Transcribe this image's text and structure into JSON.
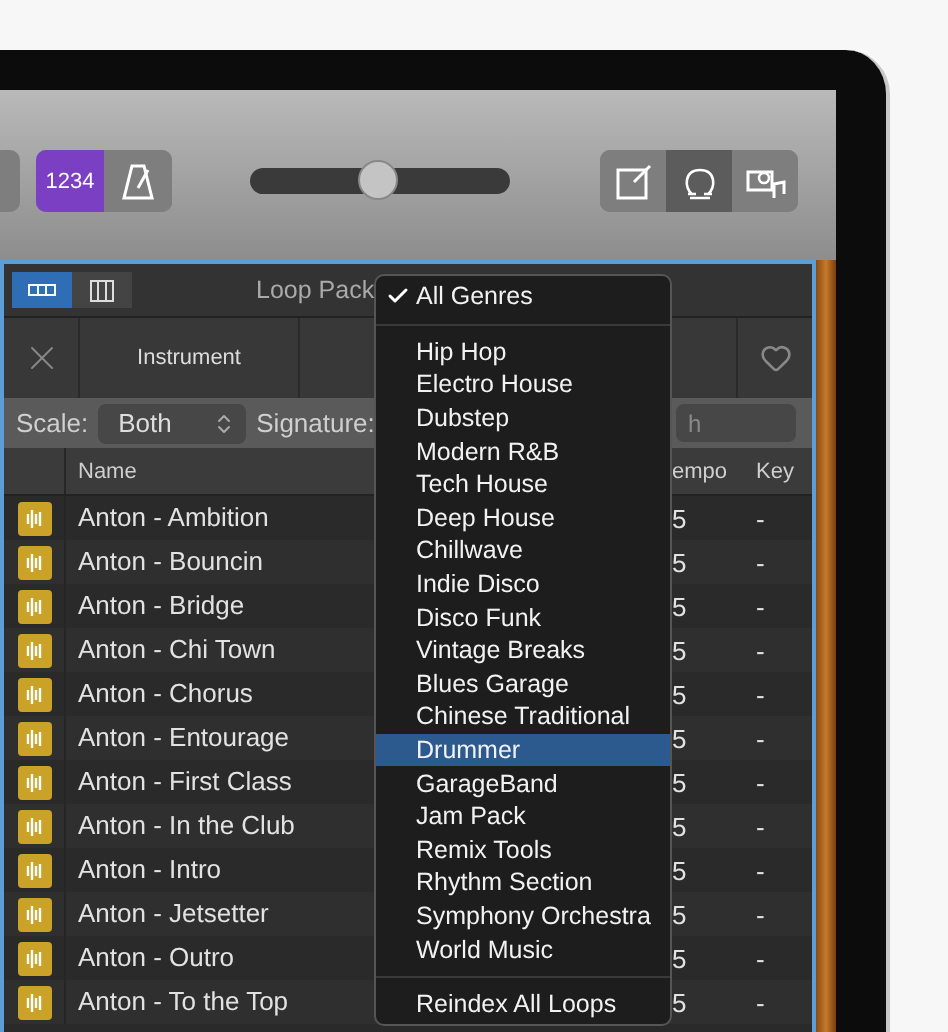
{
  "toolbar": {
    "count_in": {
      "label": "1234",
      "on": true
    },
    "metronome": {
      "on": false
    },
    "volume": {
      "level": 0.49
    },
    "view_buttons": [
      {
        "kind": "editor",
        "selected": false
      },
      {
        "kind": "loops",
        "selected": true
      },
      {
        "kind": "media",
        "selected": false
      }
    ]
  },
  "loop_browser": {
    "view_modes": [
      {
        "kind": "buttons",
        "selected": true
      },
      {
        "kind": "columns",
        "selected": false
      }
    ],
    "title": "Loop Pack",
    "filter_tab": "Instrument",
    "scale": {
      "label": "Scale:",
      "value": "Both"
    },
    "signature": {
      "label": "Signature:"
    },
    "search": {
      "placeholder": "h"
    },
    "columns": [
      "Name",
      "empo",
      "Key"
    ],
    "rows": [
      {
        "name": "Anton - Ambition",
        "tempo": "5",
        "key": "-"
      },
      {
        "name": "Anton - Bouncin",
        "tempo": "5",
        "key": "-"
      },
      {
        "name": "Anton - Bridge",
        "tempo": "5",
        "key": "-"
      },
      {
        "name": "Anton - Chi Town",
        "tempo": "5",
        "key": "-"
      },
      {
        "name": "Anton - Chorus",
        "tempo": "5",
        "key": "-"
      },
      {
        "name": "Anton - Entourage",
        "tempo": "5",
        "key": "-"
      },
      {
        "name": "Anton - First Class",
        "tempo": "5",
        "key": "-"
      },
      {
        "name": "Anton - In the Club",
        "tempo": "5",
        "key": "-"
      },
      {
        "name": "Anton - Intro",
        "tempo": "5",
        "key": "-"
      },
      {
        "name": "Anton - Jetsetter",
        "tempo": "5",
        "key": "-"
      },
      {
        "name": "Anton - Outro",
        "tempo": "5",
        "key": "-"
      },
      {
        "name": "Anton - To the Top",
        "tempo": "5",
        "key": "-"
      }
    ]
  },
  "genre_menu": {
    "items": [
      {
        "kind": "item",
        "label": "All Genres",
        "checked": true,
        "highlighted": false
      },
      {
        "kind": "separator"
      },
      {
        "kind": "item",
        "label": "Hip Hop",
        "checked": false,
        "highlighted": false
      },
      {
        "kind": "item",
        "label": "Electro House",
        "checked": false,
        "highlighted": false
      },
      {
        "kind": "item",
        "label": "Dubstep",
        "checked": false,
        "highlighted": false
      },
      {
        "kind": "item",
        "label": "Modern R&B",
        "checked": false,
        "highlighted": false
      },
      {
        "kind": "item",
        "label": "Tech House",
        "checked": false,
        "highlighted": false
      },
      {
        "kind": "item",
        "label": "Deep House",
        "checked": false,
        "highlighted": false
      },
      {
        "kind": "item",
        "label": "Chillwave",
        "checked": false,
        "highlighted": false
      },
      {
        "kind": "item",
        "label": "Indie Disco",
        "checked": false,
        "highlighted": false
      },
      {
        "kind": "item",
        "label": "Disco Funk",
        "checked": false,
        "highlighted": false
      },
      {
        "kind": "item",
        "label": "Vintage Breaks",
        "checked": false,
        "highlighted": false
      },
      {
        "kind": "item",
        "label": "Blues Garage",
        "checked": false,
        "highlighted": false
      },
      {
        "kind": "item",
        "label": "Chinese Traditional",
        "checked": false,
        "highlighted": false
      },
      {
        "kind": "item",
        "label": "Drummer",
        "checked": false,
        "highlighted": true
      },
      {
        "kind": "item",
        "label": "GarageBand",
        "checked": false,
        "highlighted": false
      },
      {
        "kind": "item",
        "label": "Jam Pack",
        "checked": false,
        "highlighted": false
      },
      {
        "kind": "item",
        "label": "Remix Tools",
        "checked": false,
        "highlighted": false
      },
      {
        "kind": "item",
        "label": "Rhythm Section",
        "checked": false,
        "highlighted": false
      },
      {
        "kind": "item",
        "label": "Symphony Orchestra",
        "checked": false,
        "highlighted": false
      },
      {
        "kind": "item",
        "label": "World Music",
        "checked": false,
        "highlighted": false
      },
      {
        "kind": "separator"
      },
      {
        "kind": "item",
        "label": "Reindex All Loops",
        "checked": false,
        "highlighted": false
      }
    ]
  }
}
